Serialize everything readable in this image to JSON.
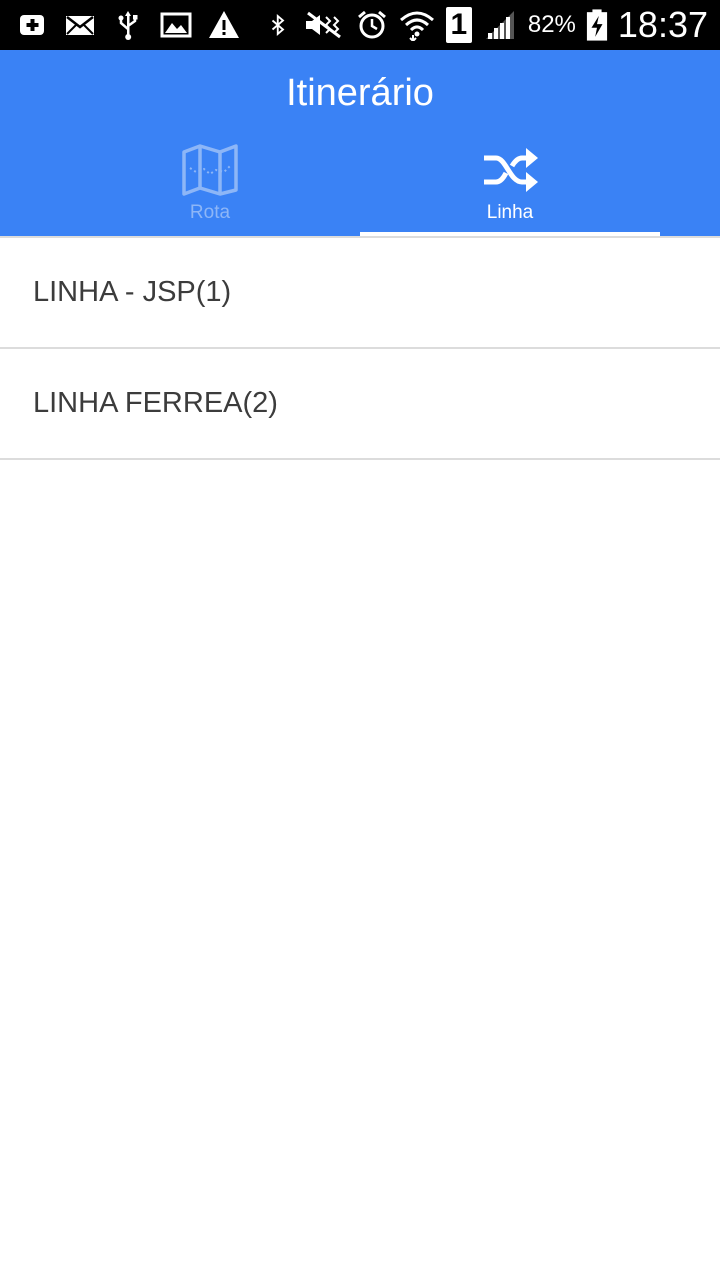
{
  "status_bar": {
    "battery_percent": "82%",
    "time": "18:37",
    "sim_slot": "1",
    "icons_left": [
      "add-box-icon",
      "mail-icon",
      "usb-icon",
      "image-icon",
      "warning-icon"
    ],
    "icons_right": [
      "bluetooth-icon",
      "mute-icon",
      "alarm-icon",
      "wifi-icon",
      "sim-icon",
      "signal-icon",
      "battery-charging-icon"
    ]
  },
  "header": {
    "title": "Itinerário",
    "background": "#3a82f5"
  },
  "tabs": [
    {
      "label": "Rota",
      "icon": "map-icon",
      "selected": false
    },
    {
      "label": "Linha",
      "icon": "shuffle-icon",
      "selected": true
    }
  ],
  "list": {
    "items": [
      {
        "label": "LINHA - JSP(1)"
      },
      {
        "label": "LINHA FERREA(2)"
      }
    ]
  }
}
